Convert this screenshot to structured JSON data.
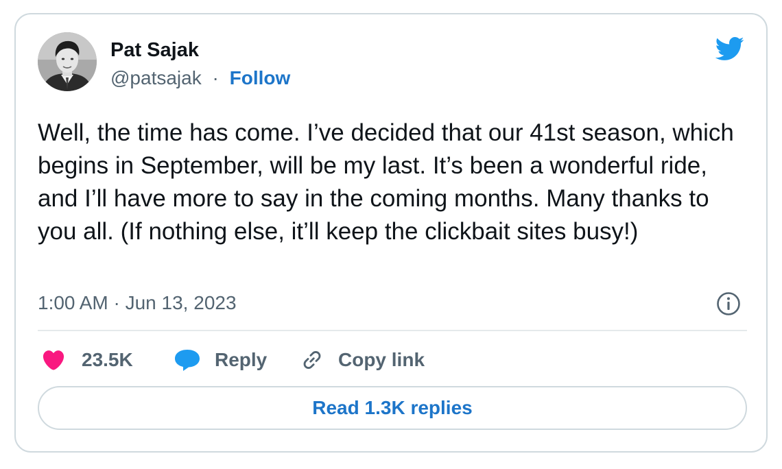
{
  "author": {
    "name": "Pat Sajak",
    "handle": "@patsajak",
    "separator": "·",
    "follow_label": "Follow"
  },
  "tweet": {
    "text": "Well, the time has come. I’ve decided that our 41st season, which begins in September, will be my last. It’s been a wonderful ride, and I’ll have more to say in the coming months. Many thanks to you all. (If nothing else, it’ll keep the clickbait sites busy!)",
    "timestamp": "1:00 AM · Jun 13, 2023"
  },
  "actions": {
    "likes_count": "23.5K",
    "reply_label": "Reply",
    "copy_link_label": "Copy link"
  },
  "read_replies_label": "Read 1.3K replies",
  "icons": {
    "brand": "twitter-bird-icon",
    "info": "info-icon",
    "like": "heart-icon",
    "reply": "speech-bubble-icon",
    "copy": "link-icon"
  },
  "colors": {
    "accent": "#1d75c9",
    "twitter_blue": "#1d9bf0",
    "like_red": "#f91880",
    "secondary_text": "#536471",
    "border": "#cfd9de"
  }
}
